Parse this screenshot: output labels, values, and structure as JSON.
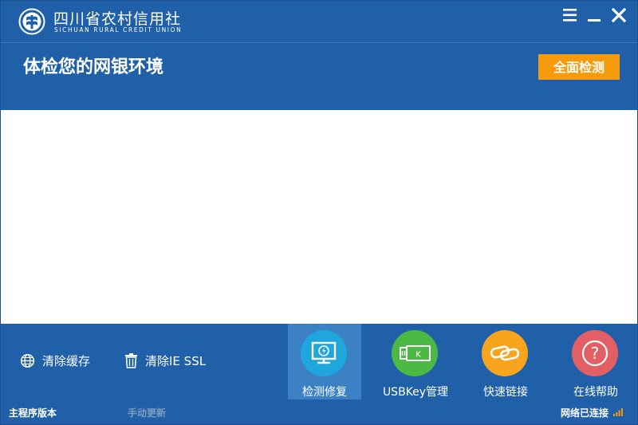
{
  "brand": {
    "name_cn": "四川省农村信用社",
    "name_en": "SICHUAN RURAL CREDIT UNION",
    "logo_icon": "credit-union-emblem-icon"
  },
  "window_controls": [
    {
      "name": "menu-icon"
    },
    {
      "name": "minimize-icon"
    },
    {
      "name": "close-icon"
    }
  ],
  "header": {
    "title": "体检您的网银环境",
    "scan_button": "全面检测"
  },
  "toolbar": {
    "links": [
      {
        "label": "清除缓存",
        "icon": "globe-icon"
      },
      {
        "label": "清除IE SSL",
        "icon": "trash-icon"
      }
    ],
    "tiles": [
      {
        "label": "检测修复",
        "icon": "monitor-repair-icon",
        "color": "#1fa6dc",
        "active": true
      },
      {
        "label": "USBKey管理",
        "icon": "usbkey-icon",
        "color": "#4cb944",
        "active": false
      },
      {
        "label": "快速链接",
        "icon": "link-icon",
        "color": "#f7a51c",
        "active": false
      },
      {
        "label": "在线帮助",
        "icon": "help-icon",
        "color": "#e25f63",
        "active": false
      }
    ]
  },
  "status": {
    "version_label": "主程序版本",
    "update_label": "手动更新",
    "network_label": "网络已连接",
    "signal_icon": "signal-bars-icon"
  },
  "colors": {
    "primary_blue": "#2060a9",
    "active_tile": "#3c81c4",
    "accent_orange": "#f79a0b"
  }
}
